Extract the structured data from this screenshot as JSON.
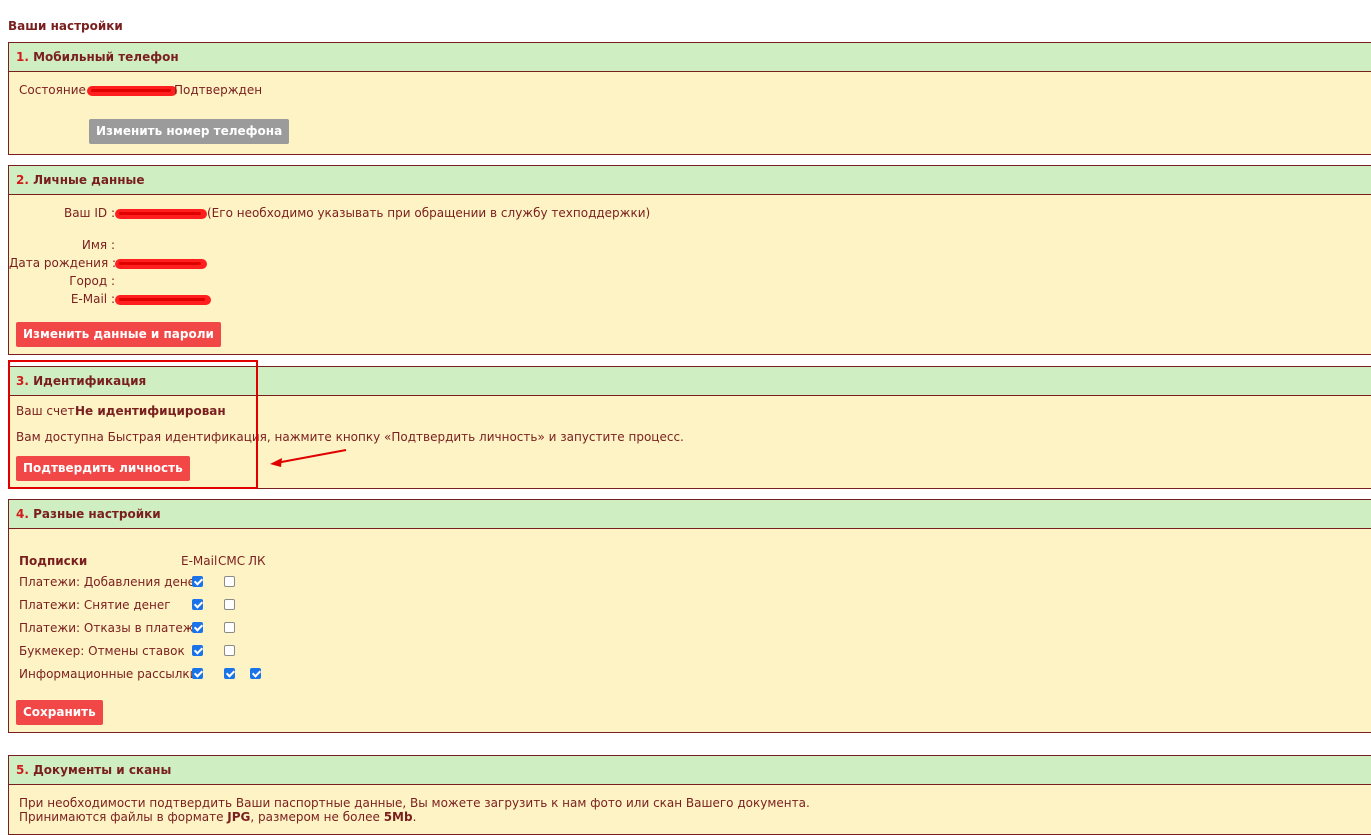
{
  "page": {
    "title": "Ваши настройки"
  },
  "section1": {
    "num": "1.",
    "title": "Мобильный телефон",
    "state_label": "Состояние :",
    "state_value": "Подтвержден",
    "button": "Изменить номер телефона"
  },
  "section2": {
    "num": "2.",
    "title": "Личные данные",
    "id_label": "Ваш ID :",
    "id_note": "(Его необходимо указывать при обращении в службу техподдержки)",
    "name_label": "Имя :",
    "birth_label": "Дата рождения :",
    "city_label": "Город :",
    "email_label": "E-Mail :",
    "button": "Изменить данные и пароли"
  },
  "section3": {
    "num": "3.",
    "title": "Идентификация",
    "account_label": "Ваш счет:",
    "account_status": "Не идентифицирован",
    "info": "Вам доступна Быстрая идентификация, нажмите кнопку «Подтвердить личность» и запустите процесс.",
    "button": "Подтвердить личность"
  },
  "section4": {
    "num": "4.",
    "title": "Разные настройки",
    "subs_header": "Подписки",
    "col_email": "E-Mail",
    "col_sms": "СМС",
    "col_lk": "ЛК",
    "rows": [
      {
        "label": "Платежи: Добавления денег",
        "email": true,
        "sms": false,
        "lk": null
      },
      {
        "label": "Платежи: Снятие денег",
        "email": true,
        "sms": false,
        "lk": null
      },
      {
        "label": "Платежи: Отказы в платеже",
        "email": true,
        "sms": false,
        "lk": null
      },
      {
        "label": "Букмекер: Отмены ставок",
        "email": true,
        "sms": false,
        "lk": null
      },
      {
        "label": "Информационные рассылки",
        "email": true,
        "sms": true,
        "lk": true
      }
    ],
    "button": "Сохранить"
  },
  "section5": {
    "num": "5.",
    "title": "Документы и сканы",
    "line1": "При необходимости подтвердить Ваши паспортные данные, Вы можете загрузить к нам фото или скан Вашего документа.",
    "line2_a": "Принимаются файлы в формате ",
    "line2_b": "JPG",
    "line2_c": ", размером не более ",
    "line2_d": "5Mb",
    "line2_e": "."
  },
  "colors": {
    "accent_red": "#f24747",
    "header_green": "#cfefc3",
    "panel_yellow": "#fdf3c4",
    "text_maroon": "#7a1f1f"
  }
}
